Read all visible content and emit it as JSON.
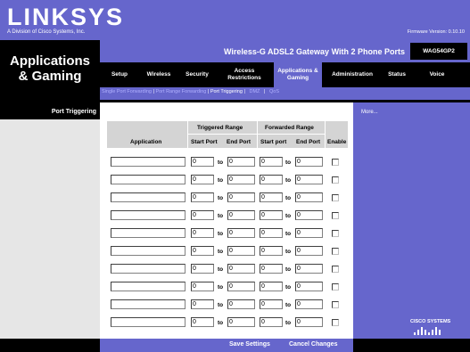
{
  "header": {
    "logo": "LINKSYS",
    "logo_sub": "A Division of Cisco Systems, Inc.",
    "firmware": "Firmware Version: 0.10.10",
    "product_name": "Wireless-G ADSL2 Gateway With 2 Phone Ports",
    "model": "WAG54GP2",
    "page_title_line1": "Applications",
    "page_title_line2": "& Gaming",
    "brand_color": "#6666cc"
  },
  "tabs": [
    {
      "label": "Setup"
    },
    {
      "label": "Wireless"
    },
    {
      "label": "Security"
    },
    {
      "label": "Access Restrictions"
    },
    {
      "label": "Applications & Gaming"
    },
    {
      "label": "Administration"
    },
    {
      "label": "Status"
    },
    {
      "label": "Voice"
    }
  ],
  "subtabs": {
    "single": "Single Port Forwarding",
    "range": "Port Range Forwarding",
    "trigger": "Port Triggering",
    "dmz": "DMZ",
    "qos": "QoS",
    "sep": "|"
  },
  "sidebar": {
    "section_title": "Port Triggering",
    "more_link": "More..."
  },
  "table": {
    "triggered_range": "Triggered Range",
    "forwarded_range": "Forwarded Range",
    "col_application": "Application",
    "col_start_port": "Start Port",
    "col_end_port": "End Port",
    "col_start_port2": "Start port",
    "col_end_port2": "End Port",
    "col_enable": "Enable",
    "to_label": "to",
    "rows": [
      {
        "application": "",
        "trig_start": "0",
        "trig_end": "0",
        "fwd_start": "0",
        "fwd_end": "0",
        "enabled": false
      },
      {
        "application": "",
        "trig_start": "0",
        "trig_end": "0",
        "fwd_start": "0",
        "fwd_end": "0",
        "enabled": false
      },
      {
        "application": "",
        "trig_start": "0",
        "trig_end": "0",
        "fwd_start": "0",
        "fwd_end": "0",
        "enabled": false
      },
      {
        "application": "",
        "trig_start": "0",
        "trig_end": "0",
        "fwd_start": "0",
        "fwd_end": "0",
        "enabled": false
      },
      {
        "application": "",
        "trig_start": "0",
        "trig_end": "0",
        "fwd_start": "0",
        "fwd_end": "0",
        "enabled": false
      },
      {
        "application": "",
        "trig_start": "0",
        "trig_end": "0",
        "fwd_start": "0",
        "fwd_end": "0",
        "enabled": false
      },
      {
        "application": "",
        "trig_start": "0",
        "trig_end": "0",
        "fwd_start": "0",
        "fwd_end": "0",
        "enabled": false
      },
      {
        "application": "",
        "trig_start": "0",
        "trig_end": "0",
        "fwd_start": "0",
        "fwd_end": "0",
        "enabled": false
      },
      {
        "application": "",
        "trig_start": "0",
        "trig_end": "0",
        "fwd_start": "0",
        "fwd_end": "0",
        "enabled": false
      },
      {
        "application": "",
        "trig_start": "0",
        "trig_end": "0",
        "fwd_start": "0",
        "fwd_end": "0",
        "enabled": false
      }
    ]
  },
  "footer": {
    "save": "Save Settings",
    "cancel": "Cancel Changes"
  },
  "brand": {
    "cisco": "CISCO SYSTEMS"
  }
}
